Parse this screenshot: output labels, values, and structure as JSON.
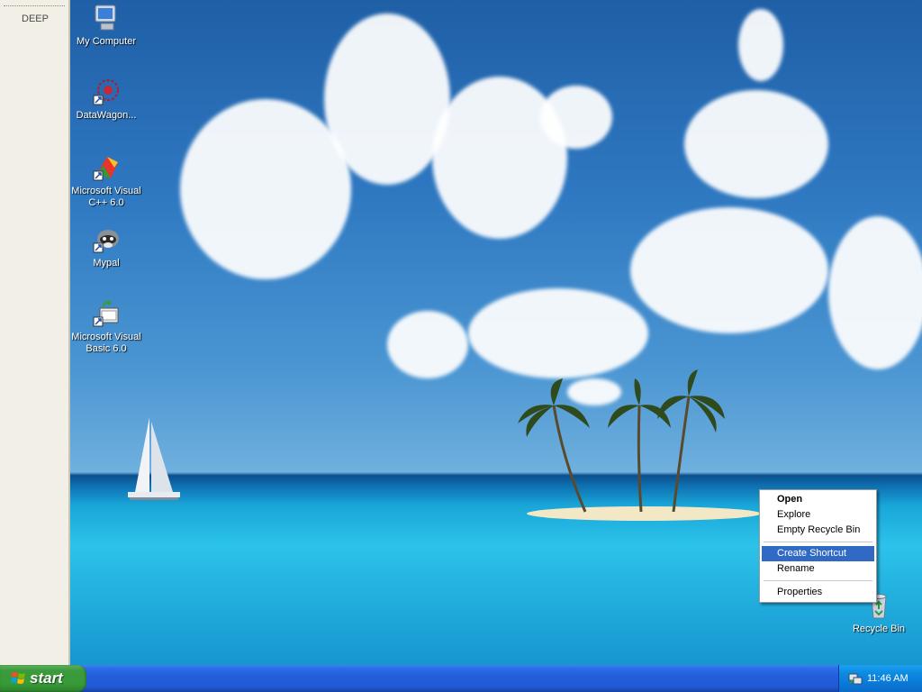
{
  "side_panel": {
    "title": "DEEP"
  },
  "desktop_icons": [
    {
      "label": "My Computer",
      "icon": "my-computer-icon"
    },
    {
      "label": "DataWagon...",
      "icon": "datawagon-icon"
    },
    {
      "label": "Microsoft Visual C++ 6.0",
      "icon": "visual-cpp-icon"
    },
    {
      "label": "Mypal",
      "icon": "mypal-icon"
    },
    {
      "label": "Microsoft Visual Basic 6.0",
      "icon": "visual-basic-icon"
    },
    {
      "label": "Recycle Bin",
      "icon": "recycle-bin-icon"
    }
  ],
  "context_menu": {
    "items": [
      {
        "label": "Open",
        "bold": true
      },
      {
        "label": "Explore"
      },
      {
        "label": "Empty Recycle Bin"
      },
      {
        "label": "Create Shortcut",
        "highlighted": true
      },
      {
        "label": "Rename"
      },
      {
        "label": "Properties"
      }
    ]
  },
  "taskbar": {
    "start_label": "start",
    "clock": "11:46 AM"
  },
  "colors": {
    "menu_highlight": "#316ac5",
    "taskbar_blue": "#245edb",
    "start_green": "#379a37"
  }
}
